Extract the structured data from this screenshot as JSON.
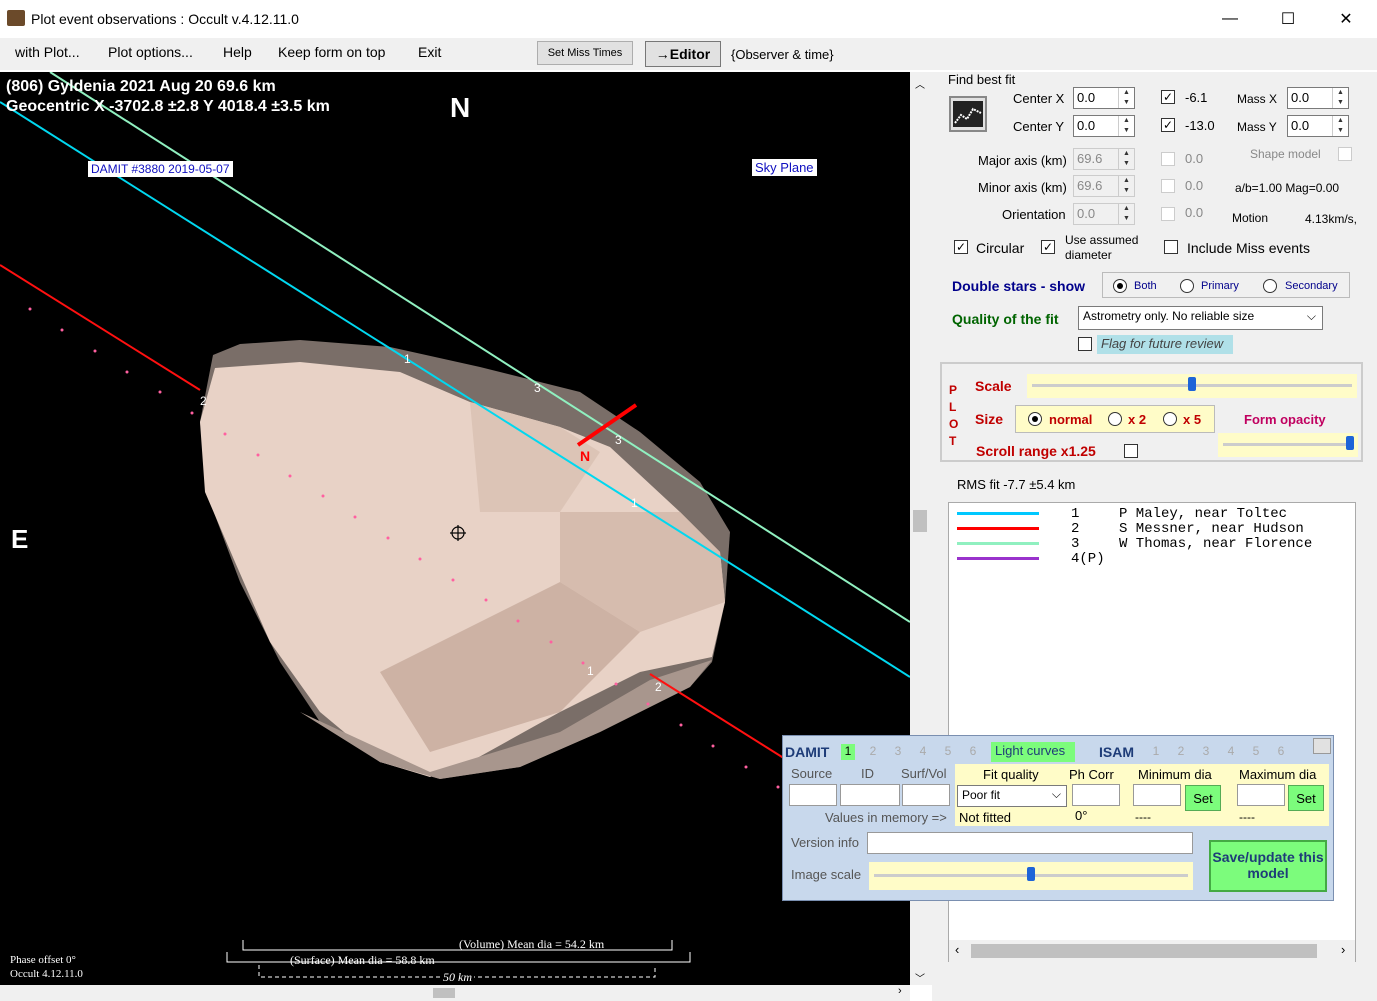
{
  "window": {
    "title": "Plot event observations : Occult v.4.12.11.0",
    "minimize": "—",
    "maximize": "☐",
    "close": "✕"
  },
  "menu": {
    "items": [
      "with Plot...",
      "Plot options...",
      "Help",
      "Keep form on top",
      "Exit"
    ],
    "set_miss_times": "Set Miss Times",
    "editor": "→Editor",
    "observer_time": "{Observer & time}"
  },
  "plot": {
    "header_line1": "(806) Gyldenia  2021 Aug 20   69.6 km",
    "header_line2": "Geocentric  X  -3702.8 ±2.8  Y 4018.4 ±3.5 km",
    "north": "N",
    "east": "E",
    "damit_label": "DAMIT #3880 2019-05-07",
    "sky_plane": "Sky Plane",
    "chord_labels": [
      "1",
      "3",
      "2",
      "3",
      "1",
      "2",
      "1"
    ],
    "miss_marker": "N",
    "volume_dia": "(Volume) Mean dia = 54.2 km",
    "surface_dia": "(Surface) Mean dia = 58.8 km",
    "scale_bar": "50 km",
    "phase_offset": "Phase offset 0°",
    "occult_version": "Occult 4.12.11.0"
  },
  "fit": {
    "find_best_fit": "Find best fit",
    "center_x_label": "Center X",
    "center_x": "0.0",
    "center_x_val": "-6.1",
    "center_y_label": "Center Y",
    "center_y": "0.0",
    "center_y_val": "-13.0",
    "mass_x_label": "Mass X",
    "mass_x": "0.0",
    "mass_y_label": "Mass Y",
    "mass_y": "0.0",
    "major_label": "Major axis (km)",
    "major": "69.6",
    "major_val": "0.0",
    "minor_label": "Minor axis (km)",
    "minor": "69.6",
    "minor_val": "0.0",
    "orient_label": "Orientation",
    "orient": "0.0",
    "orient_val": "0.0",
    "shape_model": "Shape model",
    "ab": "a/b=1.00 Mag=0.00",
    "motion_label": "Motion",
    "motion": "4.13km/s,",
    "circular": "Circular",
    "use_assumed": "Use assumed diameter",
    "include_miss": "Include Miss events"
  },
  "double_stars": {
    "label": "Double stars - show",
    "options": [
      "Both",
      "Primary",
      "Secondary"
    ],
    "selected": "Both"
  },
  "quality": {
    "label": "Quality of the fit",
    "value": "Astrometry only. No reliable size",
    "flag": "Flag for future review"
  },
  "plot_panel": {
    "side": [
      "P",
      "L",
      "O",
      "T"
    ],
    "scale": "Scale",
    "scale_pos": 0.5,
    "size": "Size",
    "size_options": [
      "normal",
      "x 2",
      "x 5"
    ],
    "size_selected": "normal",
    "form_opacity": "Form opacity",
    "opacity_pos": 0.98,
    "scroll_range": "Scroll range x1.25"
  },
  "rms": "RMS fit -7.7 ±5.4 km",
  "legend": [
    {
      "num": "1",
      "text": "P Maley, near Toltec",
      "color": "#00c8ff"
    },
    {
      "num": "2",
      "text": "S Messner, near Hudson",
      "color": "#ff0000"
    },
    {
      "num": "3",
      "text": "W Thomas, near Florence",
      "color": "#90f0c0"
    },
    {
      "num": "4(P)",
      "text": "",
      "color": "#9932cc"
    }
  ],
  "damit_panel": {
    "damit": "DAMIT",
    "damit_nums": [
      "1",
      "2",
      "3",
      "4",
      "5",
      "6"
    ],
    "light_curves": "Light curves",
    "isam": "ISAM",
    "isam_nums": [
      "1",
      "2",
      "3",
      "4",
      "5",
      "6"
    ],
    "source": "Source",
    "id": "ID",
    "surf_vol": "Surf/Vol",
    "fit_quality": "Fit quality",
    "ph_corr": "Ph Corr",
    "min_dia": "Minimum dia",
    "max_dia": "Maximum dia",
    "fit_value": "Poor fit",
    "set": "Set",
    "values_mem": "Values in memory =>",
    "not_fitted": "Not fitted",
    "deg": "0°",
    "dashes": "----",
    "version_info": "Version info",
    "image_scale": "Image scale",
    "image_scale_pos": 0.5,
    "save": "Save/update this model"
  }
}
